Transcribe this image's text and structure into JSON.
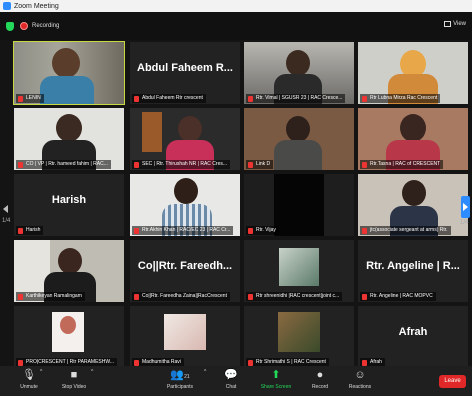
{
  "window": {
    "title": "Zoom Meeting"
  },
  "topbar": {
    "recording_label": "Recording",
    "view_label": "View"
  },
  "pager": {
    "left": "1/4",
    "right": "1/4"
  },
  "tiles": [
    {
      "name": "LENIN",
      "big": ""
    },
    {
      "name": "Abdul Faheem Rtr crescent",
      "big": "Abdul Faheem R..."
    },
    {
      "name": "Rtr. Vimal | SGUSR 23 | RAC Cresce...",
      "big": ""
    },
    {
      "name": "Rtr Lubna Mirza Rac Crescent",
      "big": ""
    },
    {
      "name": "CO | VP | Rtr. hameed fahim | RAC...",
      "big": ""
    },
    {
      "name": "SEC | Rtr. Thirushah NR | RAC Cres...",
      "big": ""
    },
    {
      "name": "Link D",
      "big": ""
    },
    {
      "name": "Rtr.Tasna | RAC of CRESCENT",
      "big": ""
    },
    {
      "name": "Harish",
      "big": "Harish"
    },
    {
      "name": "Rtr.Akhin Khan | RAC/EC 23 | RAC Cr...",
      "big": ""
    },
    {
      "name": "Rtr. Vijay",
      "big": ""
    },
    {
      "name": "jtc(associate sergeant at arms) Rtr.",
      "big": ""
    },
    {
      "name": "Karthikeyan Ramalingam",
      "big": ""
    },
    {
      "name": "Co||Rtr. Fareedha Zaina||RacCrescent",
      "big": "Co||Rtr. Fareedh..."
    },
    {
      "name": "Rtr shreenidhi |RAC crescent|joint c...",
      "big": ""
    },
    {
      "name": "Rtr. Angeline | RAC MOPVC",
      "big": "Rtr. Angeline | R..."
    },
    {
      "name": "PRO|CRESCENT | Rtr PARAMESHW...",
      "big": ""
    },
    {
      "name": "Madhumitha Ravi",
      "big": ""
    },
    {
      "name": "Rtr Shrimathi S | RAC Crescent",
      "big": ""
    },
    {
      "name": "Afrah",
      "big": "Afrah"
    }
  ],
  "toolbar": {
    "unmute": "Unmute",
    "stop_video": "Stop Video",
    "participants": "Participants",
    "participants_count": "21",
    "chat": "Chat",
    "share_screen": "Share Screen",
    "record": "Record",
    "reactions": "Reactions",
    "leave": "Leave"
  },
  "colors": {
    "active_speaker": "#c8d840",
    "share_green": "#23d959",
    "leave_red": "#e02828",
    "accent_blue": "#2d8cff"
  }
}
